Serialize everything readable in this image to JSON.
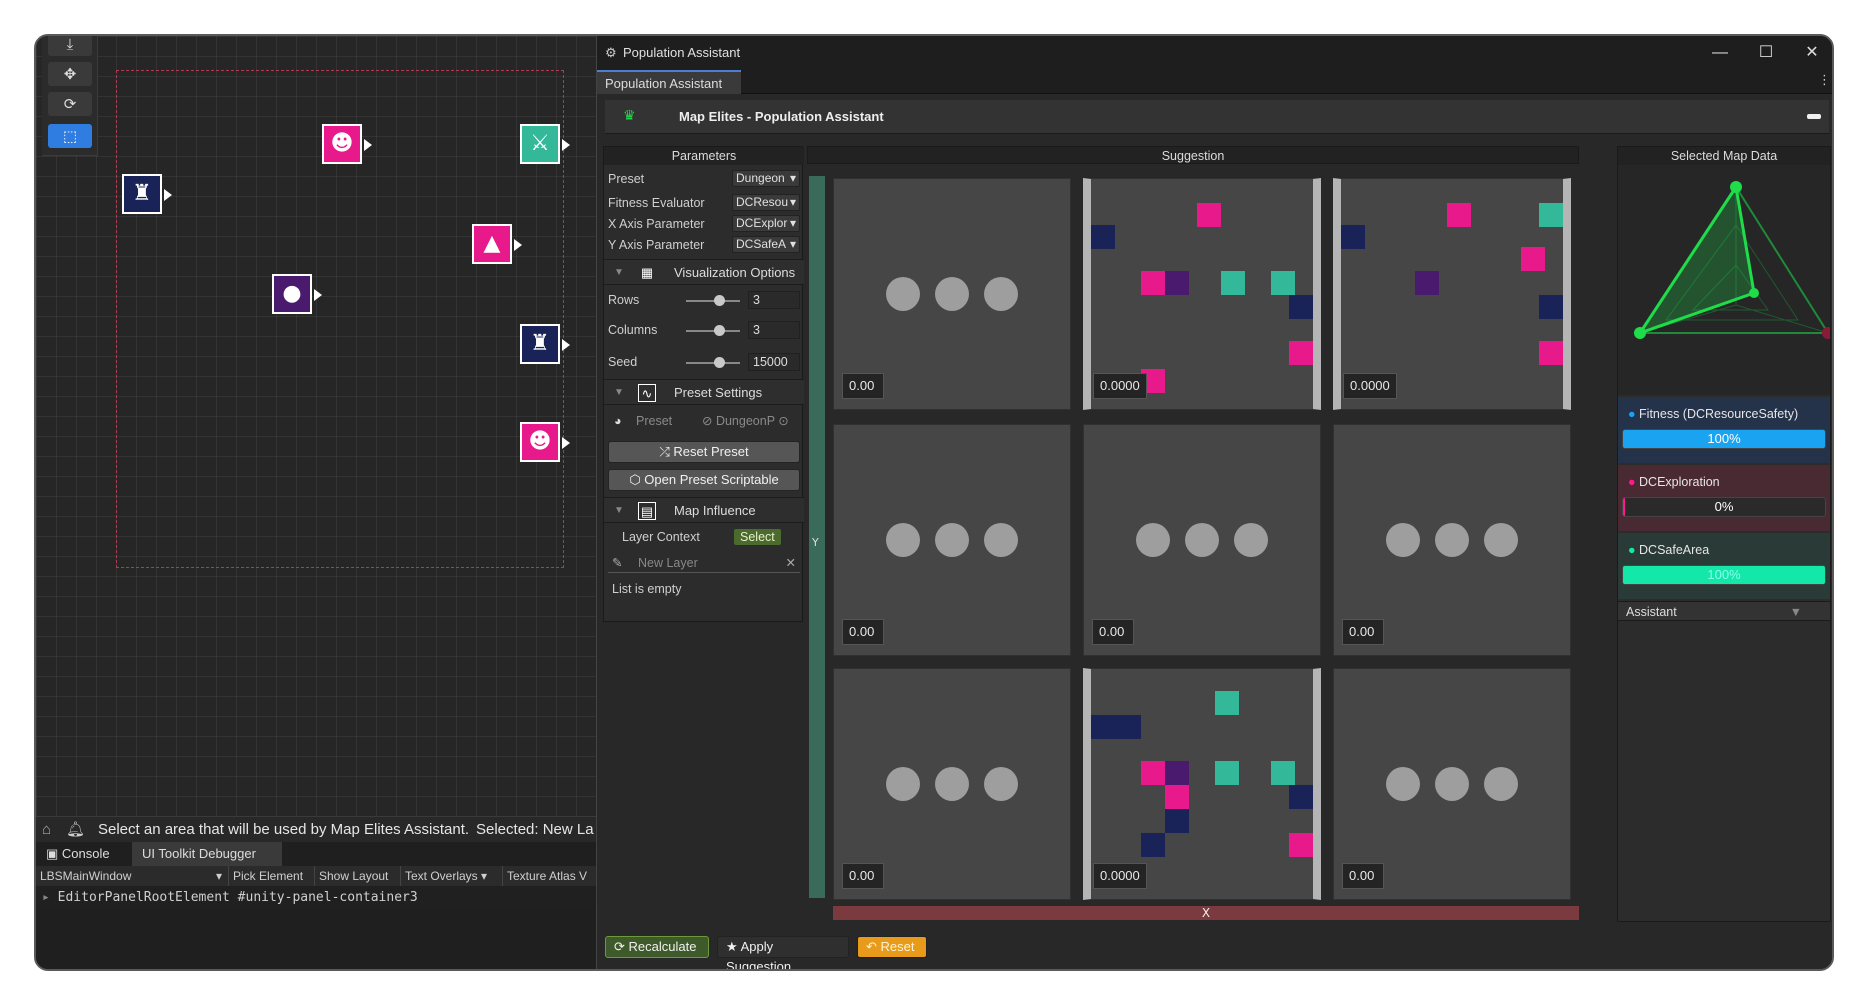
{
  "left_editor": {
    "status_message": "Select an area that will be used by Map Elites Assistant.",
    "status_selected": "Selected: New La",
    "console_tab": "Console",
    "debugger_tab": "UI Toolkit Debugger",
    "debugger_target": "LBSMainWindow",
    "pick_element": "Pick Element",
    "show_layout": "Show Layout",
    "text_overlays": "Text Overlays",
    "texture_atlas": "Texture Atlas V",
    "tree_line": "EditorPanelRootElement #unity-panel-container3"
  },
  "window": {
    "title": "Population Assistant",
    "tab": "Population Assistant",
    "header_title": "Map Elites - Population Assistant"
  },
  "parameters": {
    "title": "Parameters",
    "preset_label": "Preset",
    "preset_value": "Dungeon",
    "fitness_label": "Fitness Evaluator",
    "fitness_value": "DCResou",
    "xaxis_label": "X Axis Parameter",
    "xaxis_value": "DCExplor",
    "yaxis_label": "Y Axis Parameter",
    "yaxis_value": "DCSafeA",
    "viz_title": "Visualization Options",
    "rows_label": "Rows",
    "rows_value": "3",
    "rows_level": 0.4,
    "columns_label": "Columns",
    "columns_value": "3",
    "columns_level": 0.4,
    "seed_label": "Seed",
    "seed_value": "15000",
    "seed_level": 0.4,
    "preset_settings_title": "Preset Settings",
    "preset_field_label": "Preset",
    "preset_field_value": "DungeonP",
    "reset_preset": "Reset Preset",
    "open_preset": "Open Preset Scriptable",
    "map_influence_title": "Map Influence",
    "layer_context_label": "Layer Context",
    "select_button": "Select",
    "new_layer_placeholder": "New Layer",
    "list_empty": "List is empty"
  },
  "suggestion": {
    "title": "Suggestion",
    "y_axis": "Y",
    "x_axis": "X",
    "cells": [
      {
        "score": "0.00",
        "kind": "empty"
      },
      {
        "score": "0.0000",
        "kind": "map1"
      },
      {
        "score": "0.0000",
        "kind": "map2"
      },
      {
        "score": "0.00",
        "kind": "empty"
      },
      {
        "score": "0.00",
        "kind": "empty"
      },
      {
        "score": "0.00",
        "kind": "empty"
      },
      {
        "score": "0.00",
        "kind": "empty"
      },
      {
        "score": "0.0000",
        "kind": "map3"
      },
      {
        "score": "0.00",
        "kind": "empty"
      }
    ]
  },
  "selected_map_data": {
    "title": "Selected Map Data",
    "metrics": [
      {
        "label": "Fitness (DCResourceSafety)",
        "percent": "100%",
        "value": 1.0,
        "color": "#1aa3f0",
        "bg": "#24324a",
        "dot": "#1aa3f0"
      },
      {
        "label": "DCExploration",
        "percent": "0%",
        "value": 0.0,
        "color": "#ff1a8c",
        "bg": "#4a2a32",
        "dot": "#ff1a8c"
      },
      {
        "label": "DCSafeArea",
        "percent": "100%",
        "value": 1.0,
        "color": "#14e8a8",
        "bg": "#2a3a36",
        "dot": "#14e8a8"
      }
    ],
    "assistant_label": "Assistant"
  },
  "bottom": {
    "recalculate": "Recalculate",
    "apply": "Apply Suggestion",
    "reset": "Reset"
  },
  "colors": {
    "magenta": "#e8198a",
    "teal": "#34b89a",
    "navy": "#1a2358",
    "purple": "#4a1a6e",
    "blue_accent": "#2f7de0",
    "green_radar": "#1fdc4a"
  }
}
